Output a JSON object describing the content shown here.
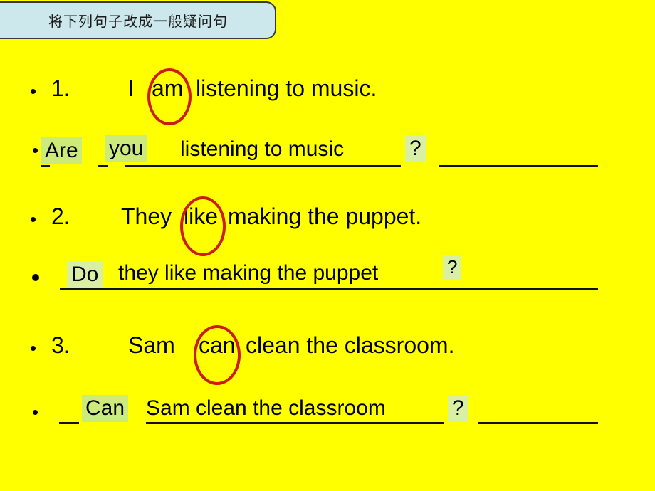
{
  "slide": {
    "background_color": "#ffff00",
    "title_box_color": "#cce8ec",
    "highlight_color": "#cdea7d",
    "circle_color": "#cc1c0c",
    "title": "将下列句子改成一般疑问句"
  },
  "items": [
    {
      "number": "1.",
      "bullet": "•",
      "question": {
        "before": "I",
        "circled_word": "am",
        "after": "listening  to  music."
      },
      "answer": {
        "word1": "Are",
        "word2": "you",
        "rest": "listening  to  music",
        "qmark": "?"
      }
    },
    {
      "number": "2.",
      "bullet": "•",
      "question": {
        "before": "They",
        "circled_word": "like",
        "after": "making the puppet."
      },
      "answer": {
        "word1": "Do",
        "rest": "they like making the puppet",
        "qmark": "?"
      }
    },
    {
      "number": "3.",
      "bullet": "•",
      "question": {
        "before": "Sam",
        "circled_word": "can",
        "after": "clean  the  classroom."
      },
      "answer": {
        "word1": "Can",
        "rest": "Sam clean  the  classroom",
        "qmark": "?"
      }
    }
  ]
}
